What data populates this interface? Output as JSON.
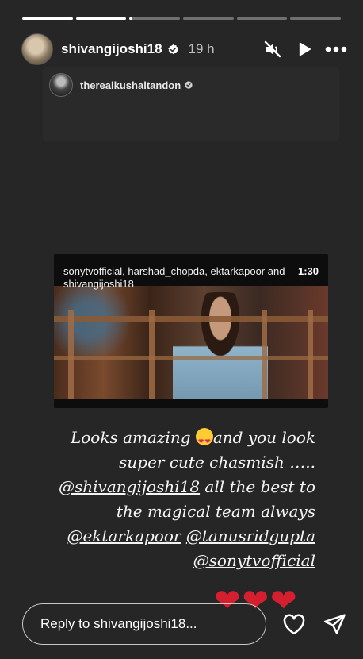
{
  "progress": {
    "segments": [
      1,
      1,
      0.05,
      0,
      0,
      0
    ]
  },
  "header": {
    "username": "shivangijoshi18",
    "time": "19 h",
    "icons": {
      "mute": "muted-speaker-icon",
      "play": "play-icon",
      "more": "more-icon",
      "verified": "verified-badge-icon"
    }
  },
  "repost": {
    "username": "therealkushaltandon",
    "icon": "verified-badge-icon"
  },
  "video": {
    "caption": "sonytvofficial, harshad_chopda, ektarkapoor and shivangijoshi18",
    "duration": "1:30"
  },
  "caption": {
    "line1_text": "Looks amazing ",
    "line1_emoji": "heart-eyes-emoji",
    "line1_tail": "and you look",
    "line2": "super cute chasmish …..",
    "mention1": "@shivangijoshi18",
    "line3_tail": " all the best to",
    "line4": "the magical team always",
    "mention2": "@ektarkapoor",
    "mention3": "@tanusridgupta",
    "mention4": "@sonytvofficial"
  },
  "stickers": {
    "hearts": [
      "❤",
      "❤",
      "❤"
    ],
    "color": "#d41f2e"
  },
  "reply": {
    "placeholder": "Reply to shivangijoshi18...",
    "icons": {
      "like": "heart-outline-icon",
      "send": "send-icon"
    }
  }
}
